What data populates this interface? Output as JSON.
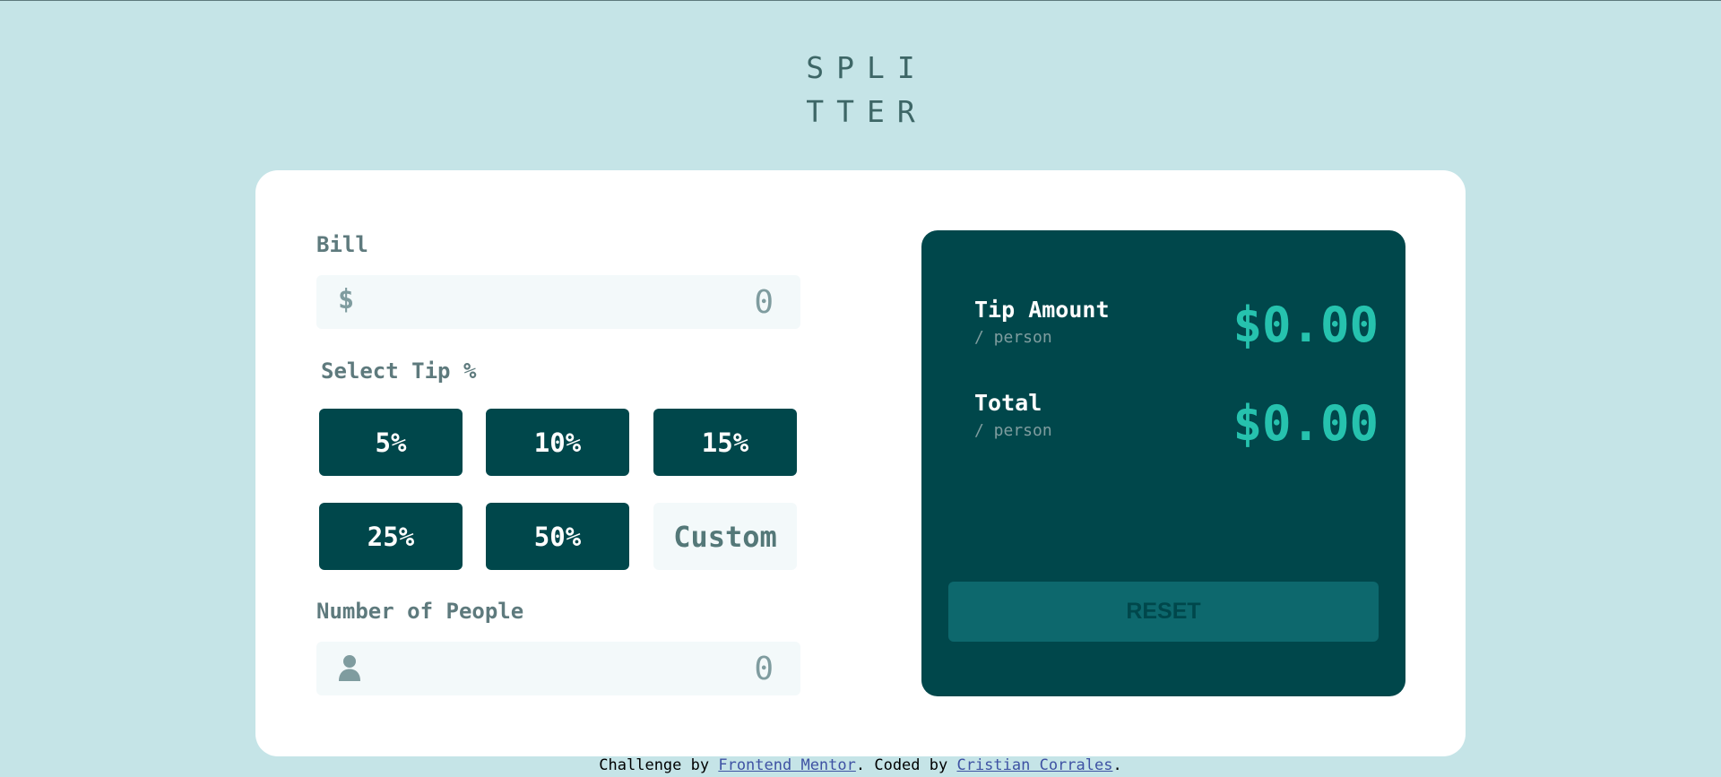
{
  "logo": {
    "line1": "SPLI",
    "line2": "TTER"
  },
  "bill": {
    "label": "Bill",
    "prefix": "$",
    "value": "0"
  },
  "tip": {
    "label": "Select Tip %",
    "options": [
      "5%",
      "10%",
      "15%",
      "25%",
      "50%"
    ],
    "custom_placeholder": "Custom"
  },
  "people": {
    "label": "Number of People",
    "value": "0",
    "icon": "person-icon"
  },
  "results": {
    "tip_amount": {
      "title": "Tip Amount",
      "sub": "/ person",
      "value": "$0.00"
    },
    "total": {
      "title": "Total",
      "sub": "/ person",
      "value": "$0.00"
    },
    "reset_label": "RESET"
  },
  "footer": {
    "prefix": "Challenge by ",
    "link1": "Frontend Mentor",
    "middle": ". Coded by ",
    "link2": "Cristian Corrales",
    "suffix": "."
  },
  "colors": {
    "background": "#c5e4e7",
    "card": "#ffffff",
    "dark_cyan": "#00474b",
    "strong_cyan": "#26c2ae",
    "input_bg": "#f3f9fa"
  }
}
